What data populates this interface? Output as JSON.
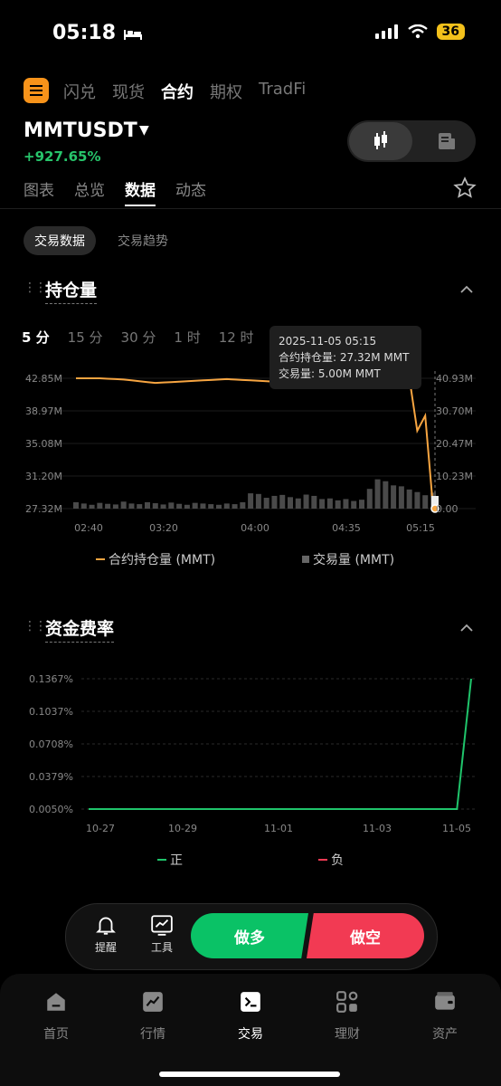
{
  "status": {
    "time": "05:18",
    "battery": "36"
  },
  "top_tabs": [
    "闪兑",
    "现货",
    "合约",
    "期权",
    "TradFi"
  ],
  "top_tabs_active": 2,
  "pair": {
    "symbol": "MMTUSDT",
    "change": "+927.65%"
  },
  "sub_tabs": [
    "图表",
    "总览",
    "数据",
    "动态"
  ],
  "sub_tabs_active": 2,
  "pills": {
    "active": "交易数据",
    "other": "交易趋势"
  },
  "oi_section": {
    "title": "持仓量",
    "ranges": [
      "5 分",
      "15 分",
      "30 分",
      "1 时",
      "12 时"
    ],
    "range_active": 0,
    "tooltip": {
      "date": "2025-11-05 05:15",
      "oi": "合约持仓量: 27.32M MMT",
      "vol": "交易量: 5.00M MMT"
    },
    "legend": {
      "oi": "合约持仓量 (MMT)",
      "vol": "交易量 (MMT)"
    }
  },
  "funding_section": {
    "title": "资金费率",
    "legend": {
      "pos": "正",
      "neg": "负"
    }
  },
  "chart_data": [
    {
      "type": "line",
      "left_axis_ticks": [
        "42.85M",
        "38.97M",
        "35.08M",
        "31.20M",
        "27.32M"
      ],
      "right_axis_ticks": [
        "40.93M",
        "30.70M",
        "20.47M",
        "10.23M",
        "0.00"
      ],
      "x_ticks": [
        "02:40",
        "03:20",
        "04:00",
        "04:35",
        "05:15"
      ],
      "ylim_left": [
        27.32,
        42.85
      ],
      "ylim_right": [
        0,
        40.93
      ],
      "series": [
        {
          "name": "合约持仓量 (MMT)",
          "color": "#f7a541",
          "values": [
            42.85,
            42.85,
            42.85,
            42.85,
            42.8,
            42.75,
            42.7,
            42.6,
            42.5,
            42.4,
            42.3,
            42.35,
            42.4,
            42.45,
            42.5,
            42.55,
            42.6,
            42.65,
            42.7,
            42.75,
            42.7,
            42.65,
            42.6,
            42.55,
            42.5,
            42.45,
            42.4,
            42.3,
            42.35,
            42.2,
            42.3,
            42.25,
            42.2,
            42.2,
            42.2,
            42.2,
            42.2,
            42.2,
            42.2,
            42.2,
            42.5,
            42.7,
            42.85,
            36.6,
            38.4,
            27.32
          ]
        },
        {
          "name": "交易量 (MMT)",
          "color": "#555555",
          "values": [
            2.0,
            1.6,
            1.2,
            1.8,
            1.5,
            1.3,
            2.2,
            1.6,
            1.4,
            2.0,
            1.7,
            1.3,
            1.9,
            1.5,
            1.2,
            1.8,
            1.6,
            1.4,
            1.2,
            1.6,
            1.4,
            2.0,
            4.8,
            4.6,
            3.4,
            4.0,
            4.3,
            3.6,
            3.2,
            4.4,
            4.0,
            3.0,
            3.2,
            2.6,
            3.0,
            2.4,
            2.8,
            6.2,
            9.2,
            8.6,
            7.3,
            7.0,
            6.0,
            5.2,
            4.2,
            5.0
          ]
        }
      ]
    },
    {
      "type": "line",
      "y_ticks": [
        "0.1367%",
        "0.1037%",
        "0.0708%",
        "0.0379%",
        "0.0050%"
      ],
      "x_ticks": [
        "10-27",
        "10-29",
        "11-01",
        "11-03",
        "11-05"
      ],
      "ylim": [
        0.005,
        0.1367
      ],
      "series": [
        {
          "name": "正",
          "color": "#1fc46b",
          "values": [
            0.005,
            0.005,
            0.005,
            0.005,
            0.005,
            0.005,
            0.005,
            0.005,
            0.005,
            0.005,
            0.005,
            0.005,
            0.005,
            0.005,
            0.005,
            0.005,
            0.005,
            0.005,
            0.005,
            0.005,
            0.005,
            0.005,
            0.005,
            0.005,
            0.005,
            0.005,
            0.005,
            0.1367
          ]
        }
      ]
    }
  ],
  "trade_bar": {
    "alert": "提醒",
    "tools": "工具",
    "long": "做多",
    "short": "做空"
  },
  "bottom_nav": [
    "首页",
    "行情",
    "交易",
    "理财",
    "资产"
  ],
  "bottom_nav_active": 2
}
